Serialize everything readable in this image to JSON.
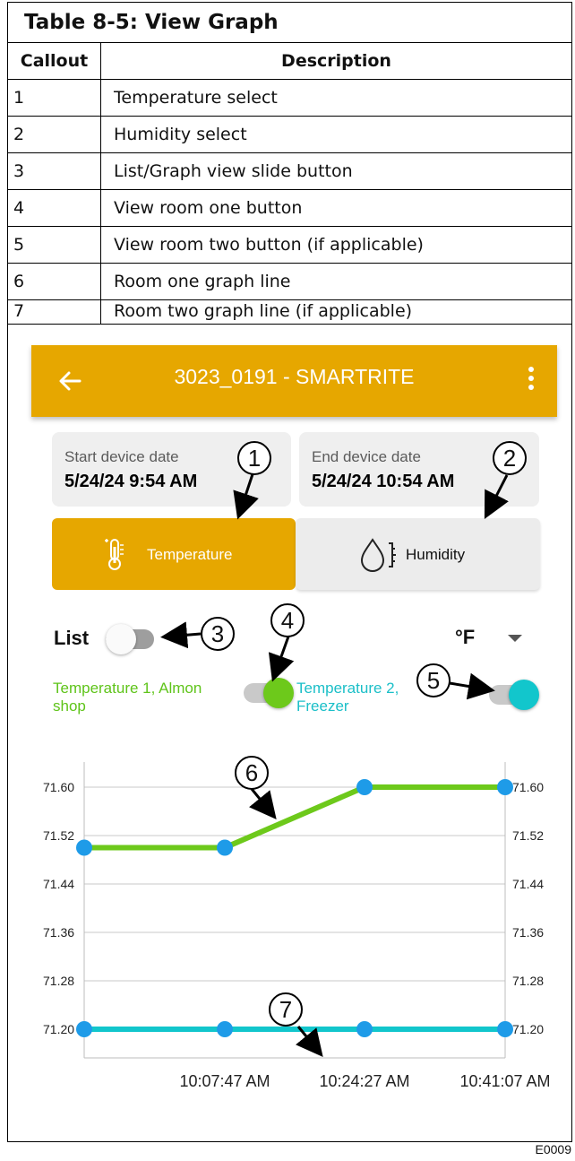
{
  "table": {
    "title": "Table 8-5:  View Graph",
    "headers": [
      "Callout",
      "Description"
    ],
    "rows": [
      [
        "1",
        "Temperature select"
      ],
      [
        "2",
        "Humidity select"
      ],
      [
        "3",
        "List/Graph view slide button"
      ],
      [
        "4",
        "View room one button"
      ],
      [
        "5",
        "View room two button (if applicable)"
      ],
      [
        "6",
        "Room one graph line"
      ],
      [
        "7",
        "Room two graph line (if applicable)"
      ]
    ]
  },
  "app": {
    "title": "3023_0191 - SMARTRITE",
    "back_icon": "arrow-left-icon",
    "menu_icon": "more-vert-icon",
    "accent_color": "#E6A700",
    "start_date": {
      "label": "Start device date",
      "value": "5/24/24 9:54 AM"
    },
    "end_date": {
      "label": "End device date",
      "value": "5/24/24 10:54 AM"
    },
    "tabs": [
      {
        "label": "Temperature",
        "icon": "thermometer-icon",
        "selected": true
      },
      {
        "label": "Humidity",
        "icon": "water-drop-icon",
        "selected": false
      }
    ],
    "list_label": "List",
    "list_toggle_on": false,
    "unit": "°F",
    "rooms": [
      {
        "label": "Temperature 1, Almon shop",
        "color": "#6DC91B",
        "enabled": true
      },
      {
        "label": "Temperature 2, Freezer",
        "color": "#12C6CC",
        "enabled": true
      }
    ]
  },
  "callouts": [
    "1",
    "2",
    "3",
    "4",
    "5",
    "6",
    "7"
  ],
  "chart_data": {
    "type": "line",
    "y_ticks": [
      "71.60",
      "71.52",
      "71.44",
      "71.36",
      "71.28",
      "71.20"
    ],
    "ylim": [
      71.16,
      71.66
    ],
    "x_ticks": [
      "10:07:47 AM",
      "10:24:27 AM",
      "10:41:07 AM"
    ],
    "x": [
      "9:51:07 AM",
      "10:07:47 AM",
      "10:24:27 AM",
      "10:41:07 AM"
    ],
    "series": [
      {
        "values": [
          71.5,
          71.5,
          71.6,
          71.6
        ],
        "color": "#6DC91B"
      },
      {
        "values": [
          71.2,
          71.2,
          71.2,
          71.2
        ],
        "color": "#12C6CC"
      }
    ],
    "point_color": "#1E9BE8",
    "grid": true
  },
  "figure_code": "E0009"
}
